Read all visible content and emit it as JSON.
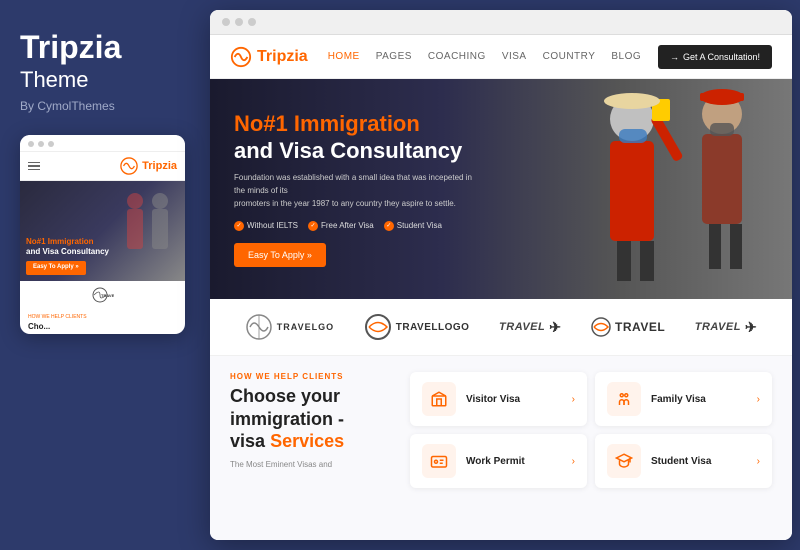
{
  "left": {
    "brand_title": "Tripzia",
    "brand_subtitle": "Theme",
    "brand_by": "By CymolThemes"
  },
  "mobile": {
    "logo_text_plain": "Trip",
    "logo_text_accent": "zia",
    "hero_line1": "No#1 Immigration",
    "hero_line2": "and Visa Consultancy",
    "cta": "Easy To Apply »",
    "section_label": "HOW WE HELP CLIENTS",
    "section_heading": "Cho..."
  },
  "browser": {
    "nav": {
      "logo_plain": "Trip",
      "logo_accent": "zia",
      "links": [
        "HOME",
        "PAGES",
        "COACHING",
        "VISA",
        "COUNTRY",
        "BLOG"
      ],
      "cta": "Get A Consultation!"
    },
    "hero": {
      "title_orange": "No#1 Immigration",
      "title_white": "and Visa Consultancy",
      "description": "Foundation was established with a small idea that was incepeted in the minds of its\npromoters in the year 1987 to any country they aspire to settle.",
      "badges": [
        "Without IELTS",
        "Free After Visa",
        "Student Visa"
      ],
      "cta": "Easy To Apply »"
    },
    "logos": [
      {
        "name": "TRAVELGO",
        "style": "bold-circle"
      },
      {
        "name": "Travellogo",
        "style": "circle-logo"
      },
      {
        "name": "travel",
        "style": "plane"
      },
      {
        "name": "Travel",
        "style": "plane2"
      },
      {
        "name": "travel",
        "style": "plane3"
      }
    ],
    "services": {
      "how_label": "HOW WE HELP CLIENTS",
      "title_line1": "Choose your",
      "title_line2": "immigration -",
      "title_line3": "visa",
      "title_accent": "Services",
      "description": "The Most Eminent Visas and",
      "cards": [
        {
          "name": "Visitor Visa",
          "icon": "building"
        },
        {
          "name": "Family Visa",
          "icon": "family"
        },
        {
          "name": "Work Permit",
          "icon": "id-card"
        },
        {
          "name": "Student Visa",
          "icon": "graduation"
        }
      ]
    }
  }
}
